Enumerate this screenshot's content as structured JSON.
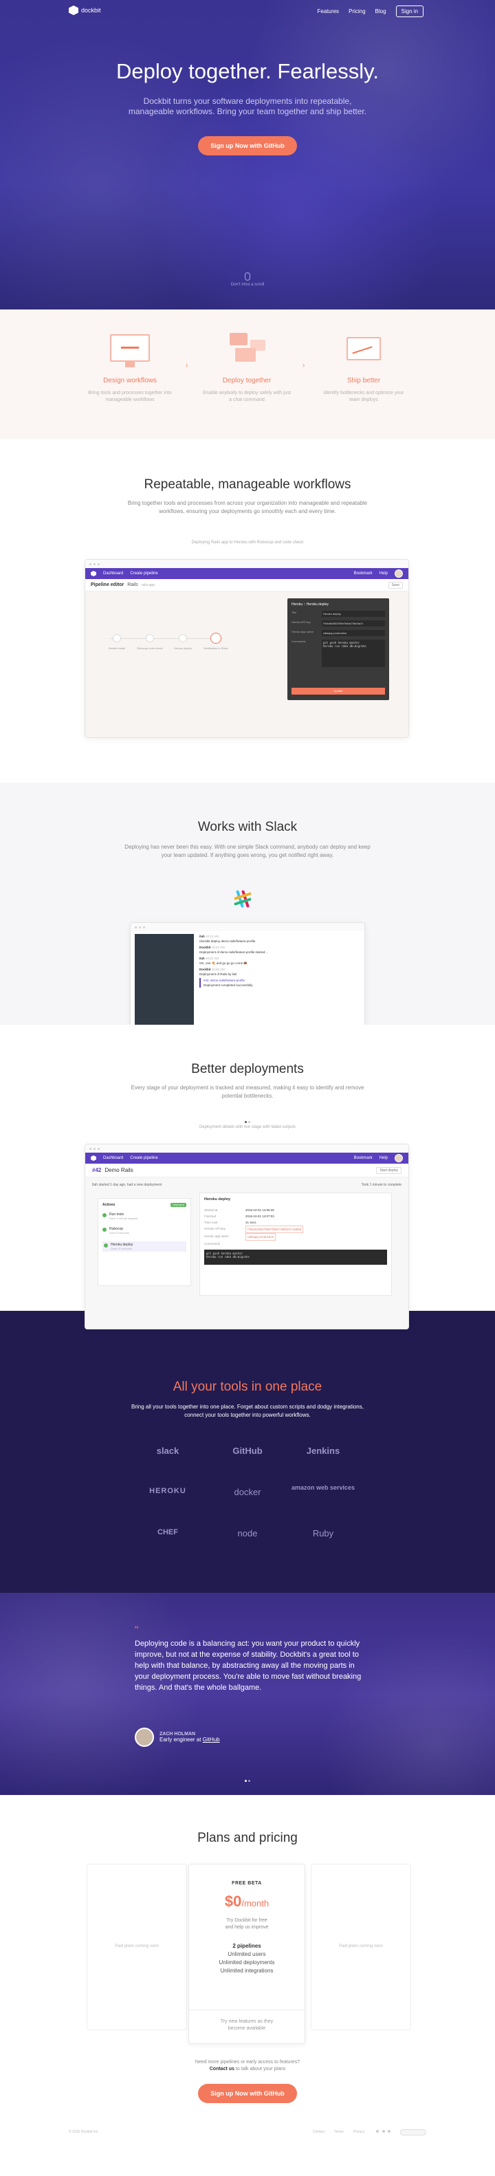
{
  "nav": {
    "brand": "dockbit",
    "links": [
      "Features",
      "Pricing",
      "Blog"
    ],
    "signin": "Sign in"
  },
  "hero": {
    "title": "Deploy together. Fearlessly.",
    "subtitle": "Dockbit turns your software deployments into repeatable, manageable workflows. Bring your team together and ship better.",
    "cta": "Sign up Now with GitHub",
    "scroll": "Don't miss a scroll"
  },
  "features": [
    {
      "title": "Design workflows",
      "text": "Bring tools and processes together into manageable workflows"
    },
    {
      "title": "Deploy together",
      "text": "Enable anybody to deploy safely with just a chat command"
    },
    {
      "title": "Ship better",
      "text": "Identify bottlenecks and optimize your team deploys"
    }
  ],
  "workflows": {
    "title": "Repeatable, manageable workflows",
    "text": "Bring together tools and processes from across your organization into manageable and repeatable workflows, ensuring your deployments go smoothly each and every time.",
    "note": "Deploying Rails app to Heroku with Rubocop and code check",
    "app": {
      "nav": [
        "Dashboard",
        "Create pipeline"
      ],
      "right": [
        "Bookmark",
        "Help"
      ],
      "editor_title": "Pipeline editor",
      "editor_app": "Rails",
      "editor_sub": "rails-app",
      "save": "Save",
      "stages": [
        "Bundle install",
        "Rubocop code check",
        "Heroku deploy",
        "Notification in Slack"
      ],
      "panel_title": "Heroku :: Heroku deploy",
      "panel_rows": [
        {
          "k": "Title",
          "v": "Heroku deploy"
        },
        {
          "k": "Heroku API key",
          "v": "f76ea5c884789e7b8dc74bb3a7c"
        },
        {
          "k": "Heroku app name",
          "v": "railsapp-production"
        }
      ],
      "panel_cmd_label": "Commands",
      "panel_cmd": "git push heroku master\nheroku run rake db:migrate",
      "panel_btn": "Update"
    }
  },
  "slack": {
    "title": "Works with Slack",
    "text": "Deploying has never been this easy. With one simple Slack command, anybody can deploy and keep your team updated. If anything goes wrong, you get notified right away.",
    "messages": [
      {
        "user": "ilah",
        "time": "10:21 AM",
        "text": "/dockbit deploy demo-rails/feature-profile"
      },
      {
        "user": "Dockbit",
        "time": "10:21 AM",
        "text": "Deployment of demo-rails/feature-profile started..."
      },
      {
        "user": "ilah",
        "time": "10:22 AM",
        "text": "OK, one 🍕 and go go go come 🍩"
      },
      {
        "user": "Dockbit",
        "time": "10:25 AM",
        "text": "Deployment of Rails by ilah"
      },
      {
        "user": "",
        "time": "",
        "text": "#42, demo-rails/feature-profile"
      },
      {
        "user": "",
        "time": "",
        "text": "Deployment completed successfully"
      }
    ]
  },
  "deploys": {
    "title": "Better deployments",
    "text": "Every stage of your deployment is tracked and measured, making it easy to identify and remove potential bottlenecks.",
    "note": "Deployment details with live stage with failed outputs",
    "app": {
      "nav": [
        "Dashboard",
        "Create pipeline"
      ],
      "right": [
        "Bookmark",
        "Help"
      ],
      "title": "Demo Rails",
      "num": "#42",
      "btn": "Start deploy",
      "status": "Ilah started 1 day ago, had a new deployment",
      "stat_right": "Took 1 minute to complete",
      "list_title": "Actions",
      "list_badge": "Deployed",
      "items": [
        {
          "name": "Run tests",
          "sub": "Done 1 minute elapsed"
        },
        {
          "name": "Rubocop",
          "sub": "Done 5 seconds"
        },
        {
          "name": "Heroku deploy",
          "sub": "Done 41 seconds"
        }
      ],
      "detail_title": "Heroku deploy",
      "detail_rows": [
        {
          "k": "Started at",
          "v": "2016-10-01 14:06:25"
        },
        {
          "k": "Finished",
          "v": "2016-10-01 14:07:03"
        },
        {
          "k": "Time took",
          "v": "41 secs"
        },
        {
          "k": "Heroku API key",
          "v": "f76ea5c884789e7b8dc74bb3a7c4a5b6"
        },
        {
          "k": "Heroku app name",
          "v": "railsapp-production"
        }
      ],
      "detail_cmd_label": "Commands",
      "detail_cmd": "git push heroku master\nheroku run rake db:migrate"
    }
  },
  "tools": {
    "title": "All your tools in one place",
    "text": "Bring all your tools together into one place. Forget about custom scripts and dodgy integrations, connect your tools together into powerful workflows.",
    "logos": [
      "slack",
      "GitHub",
      "Jenkins",
      "HEROKU",
      "docker",
      "amazon web services",
      "CHEF",
      "node",
      "Ruby"
    ]
  },
  "quote": {
    "text": "Deploying code is a balancing act: you want your product to quickly improve, but not at the expense of stability. Dockbit's a great tool to help with that balance, by abstracting away all the moving parts in your deployment process. You're able to move fast without breaking things. And that's the whole ballgame.",
    "name": "ZACH HOLMAN",
    "role": "Early engineer at",
    "company": "GitHub"
  },
  "pricing": {
    "title": "Plans and pricing",
    "side_text": "Paid plans coming soon",
    "badge": "FREE BETA",
    "price": "$0",
    "per": "/month",
    "desc": "Try Dockbit for free\nand help us improve",
    "features": [
      "2 pipelines",
      "Unlimited users",
      "Unlimited deployments",
      "Unlimited integrations"
    ],
    "note": "Try new features as they\nbecome available",
    "need": "Need more pipelines or early access to features?",
    "contact": "Contact us",
    "contact_rest": "to talk about your plans",
    "cta": "Sign up Now with GitHub"
  },
  "footer": {
    "copy": "© 2016 Dockbit Inc.",
    "links": [
      "Contact",
      "Terms",
      "Privacy"
    ]
  },
  "colors": {
    "accent": "#f4785c",
    "purple": "#5a3fc0",
    "hero": "#3e37a0",
    "tools_bg": "#221b4f"
  }
}
